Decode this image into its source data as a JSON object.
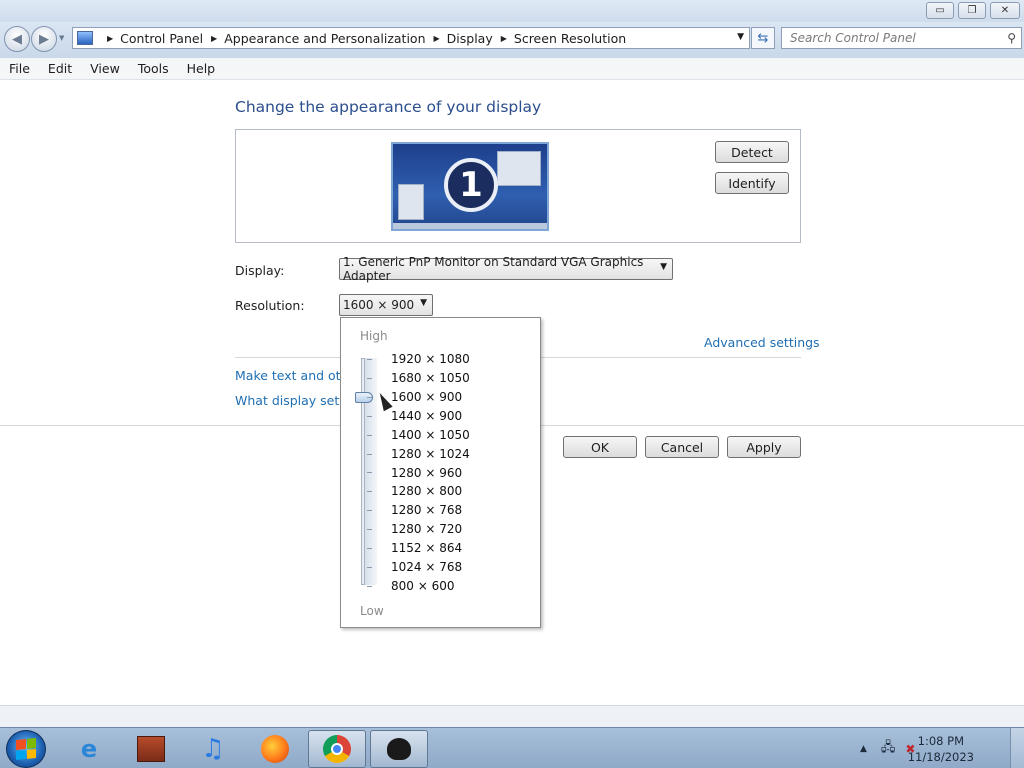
{
  "window": {
    "minimize_glyph": "▭",
    "maximize_glyph": "❐",
    "close_glyph": "✕"
  },
  "address_bar": {
    "breadcrumbs": [
      "Control Panel",
      "Appearance and Personalization",
      "Display",
      "Screen Resolution"
    ],
    "search_placeholder": "Search Control Panel"
  },
  "menu": {
    "items": [
      "File",
      "Edit",
      "View",
      "Tools",
      "Help"
    ]
  },
  "main": {
    "heading": "Change the appearance of your display",
    "monitor_number": "1",
    "detect_label": "Detect",
    "identify_label": "Identify",
    "display_label": "Display:",
    "display_value": "1. Generic PnP Monitor on Standard VGA Graphics Adapter",
    "resolution_label": "Resolution:",
    "resolution_value": "1600 × 900",
    "advanced_link": "Advanced settings",
    "link_text_size": "Make text and other",
    "link_display_settings": "What display setting",
    "ok_label": "OK",
    "cancel_label": "Cancel",
    "apply_label": "Apply"
  },
  "resolution_dropdown": {
    "high_label": "High",
    "low_label": "Low",
    "options": [
      "1920 × 1080",
      "1680 × 1050",
      "1600 × 900",
      "1440 × 900",
      "1400 × 1050",
      "1280 × 1024",
      "1280 × 960",
      "1280 × 800",
      "1280 × 768",
      "1280 × 720",
      "1152 × 864",
      "1024 × 768",
      "800 × 600"
    ],
    "selected_index": 2
  },
  "taskbar": {
    "apps": [
      "windows-explorer-icon",
      "internet-explorer-icon",
      "media-player-icon",
      "itunes-icon",
      "firefox-icon",
      "chrome-icon",
      "paint-icon"
    ],
    "time": "1:08 PM",
    "date": "11/18/2023"
  }
}
